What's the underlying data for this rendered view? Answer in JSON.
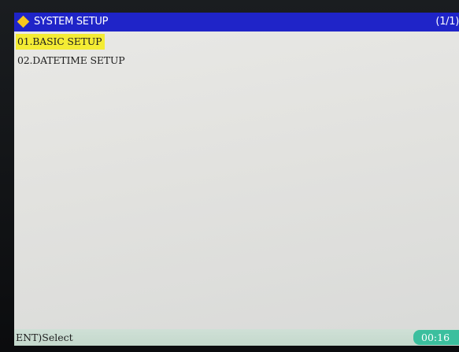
{
  "header": {
    "title": "SYSTEM SETUP",
    "page_indicator": "(1/1)",
    "icon": "diamond-icon"
  },
  "menu": {
    "items": [
      {
        "label": "01.BASIC SETUP",
        "selected": true
      },
      {
        "label": "02.DATETIME SETUP",
        "selected": false
      }
    ]
  },
  "footer": {
    "hint": "ENT)Select",
    "clock": "00:16"
  },
  "colors": {
    "titlebar": "#1f24c8",
    "highlight": "#f4ec34",
    "clock_bg": "#3bbf9e",
    "icon": "#f6c81e"
  }
}
